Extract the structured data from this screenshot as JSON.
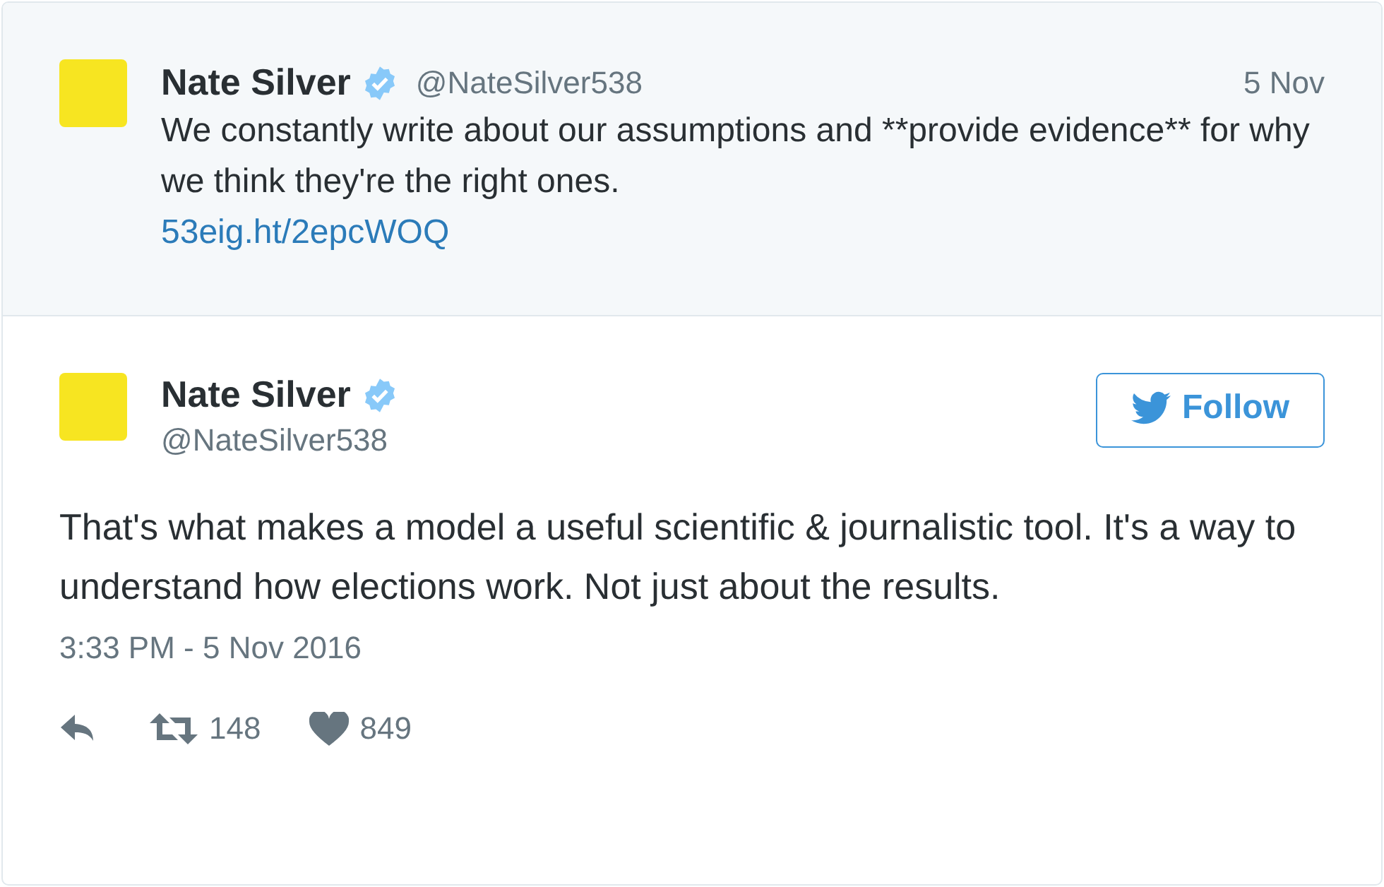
{
  "parent_tweet": {
    "name": "Nate Silver",
    "verified": true,
    "handle": "@NateSilver538",
    "date": "5 Nov",
    "text": "We constantly write about our assumptions and **provide evidence** for why we think they're the right ones.",
    "link": "53eig.ht/2epcWOQ"
  },
  "tweet": {
    "name": "Nate Silver",
    "verified": true,
    "handle": "@NateSilver538",
    "follow_label": "Follow",
    "text": "That's what makes a model a useful scientific & journalistic tool. It's a way to understand how elections work. Not just about the results.",
    "timestamp": "3:33 PM - 5 Nov 2016",
    "actions": [
      {
        "kind": "reply"
      },
      {
        "kind": "retweet",
        "count": "148"
      },
      {
        "kind": "like",
        "count": "849"
      }
    ]
  }
}
